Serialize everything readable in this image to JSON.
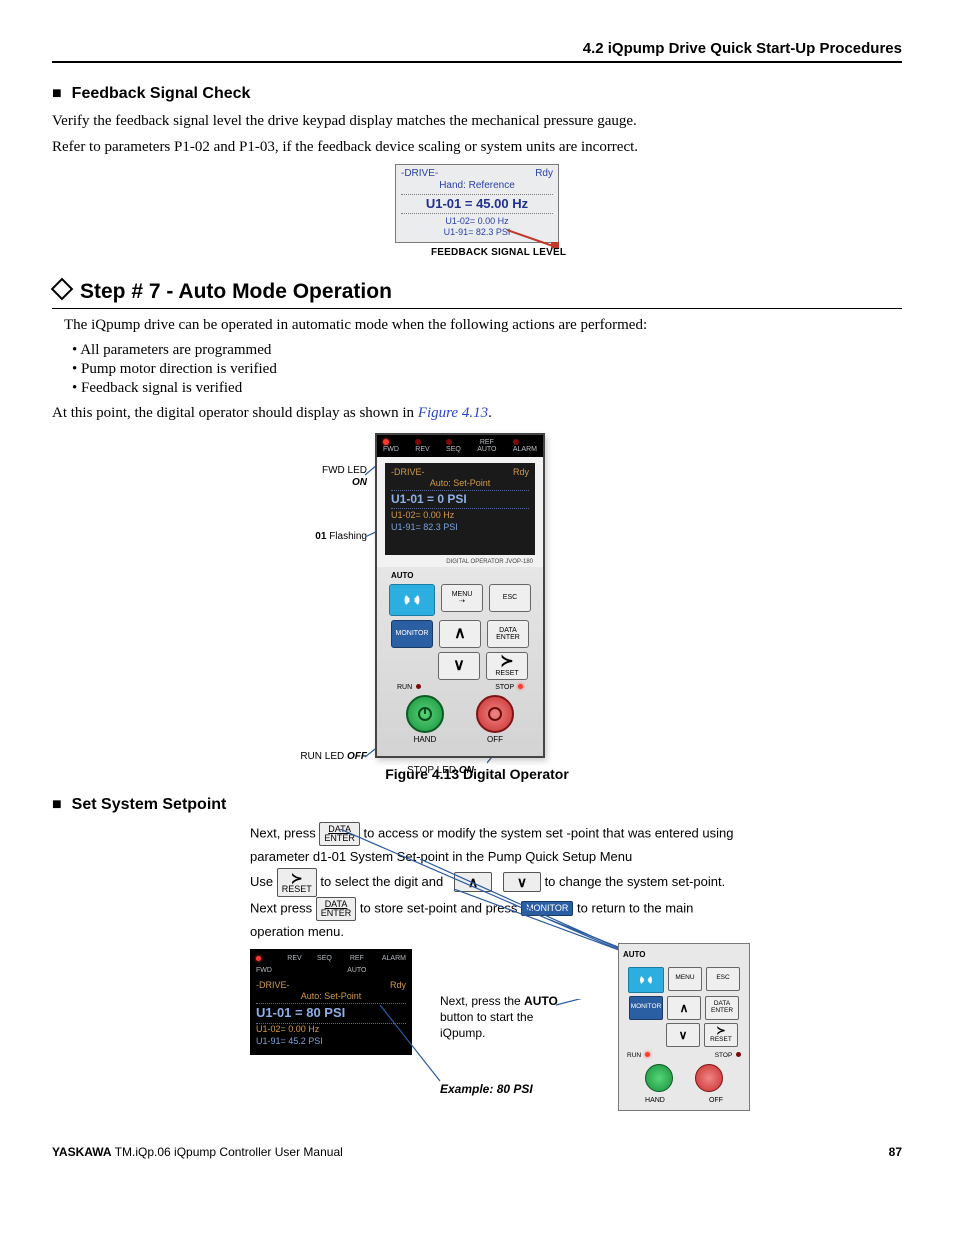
{
  "header": {
    "section": "4.2  iQpump Drive Quick Start-Up Procedures"
  },
  "feedback": {
    "heading": "Feedback Signal Check",
    "p1": "Verify the feedback signal level the drive keypad display matches the mechanical pressure gauge.",
    "p2": "Refer to parameters P1-02 and P1-03, if the feedback device scaling or system units are incorrect.",
    "lcd": {
      "drive": "-DRIVE-",
      "rdy": "Rdy",
      "mode": "Hand:  Reference",
      "u101": "U1-01 =  45.00 Hz",
      "u102": "U1-02=   0.00 Hz",
      "u191": "U1-91=   82.3 PSI"
    },
    "caption": "FEEDBACK SIGNAL LEVEL"
  },
  "step7": {
    "title": "Step # 7 - Auto Mode Operation",
    "intro": "The iQpump drive can be operated in automatic mode when the following actions are performed:",
    "bullets": [
      "All parameters are programmed",
      "Pump motor direction is verified",
      "Feedback signal is verified"
    ],
    "after_prefix": "At this point, the digital operator should display as shown in ",
    "after_link": "Figure 4.13",
    "after_suffix": ".",
    "fwd_led": "FWD LED",
    "fwd_on": "ON",
    "flash_prefix": "01",
    "flash_suffix": " Flashing",
    "run_led": "RUN LED OFF",
    "stop_led": "STOP LED ON",
    "fig_caption": "Figure 4.13  Digital Operator"
  },
  "op_lcd": {
    "drive": "-DRIVE-",
    "rdy": "Rdy",
    "mode": "Auto:  Set-Point",
    "u101": "U1-01 =       0 PSI",
    "u102": "U1-02=   0.00 Hz",
    "u191": "U1-91=   82.3 PSI",
    "label_top": "DIGITAL OPERATOR JVOP-180"
  },
  "keys": {
    "auto": "AUTO",
    "menu": "MENU",
    "esc": "ESC",
    "monitor": "MONITOR",
    "up": "∧",
    "down": "∨",
    "data": "DATA",
    "enter": "ENTER",
    "reset": "RESET",
    "right": "≻",
    "run": "RUN",
    "stop": "STOP",
    "hand": "HAND",
    "off": "OFF"
  },
  "ledbar": {
    "fwd": "FWD",
    "rev": "REV",
    "seq": "SEQ",
    "ref": "REF",
    "auto": "AUTO",
    "alarm": "ALARM"
  },
  "setpoint": {
    "heading": "Set System Setpoint",
    "l1a": "Next, press",
    "l1b": "to  access or modify the system set -point that was entered using",
    "l2": "parameter d1-01 System Set-point in the Pump Quick Setup Menu",
    "l3a": "Use",
    "l3b": "to select the digit and",
    "l3c": "to change the system set-point.",
    "l4a": "Next press",
    "l4b": "to store set-point and press",
    "l4c": "to return to the main",
    "l5": "operation menu.",
    "auto_note1": "Next, press the ",
    "auto_bold": "AUTO",
    "auto_note2": " button to start the iQpump.",
    "example": "Example: 80 PSI",
    "mini_lcd": {
      "drive": "-DRIVE-",
      "rdy": "Rdy",
      "mode": "Auto:  Set-Point",
      "u101": "U1-01 =    80 PSI",
      "u102": "U1-02=   0.00 Hz",
      "u191": "U1-91=   45.2 PSI"
    }
  },
  "footer": {
    "brand": "YASKAWA",
    "doc": " TM.iQp.06 iQpump Controller User Manual",
    "page": "87"
  }
}
